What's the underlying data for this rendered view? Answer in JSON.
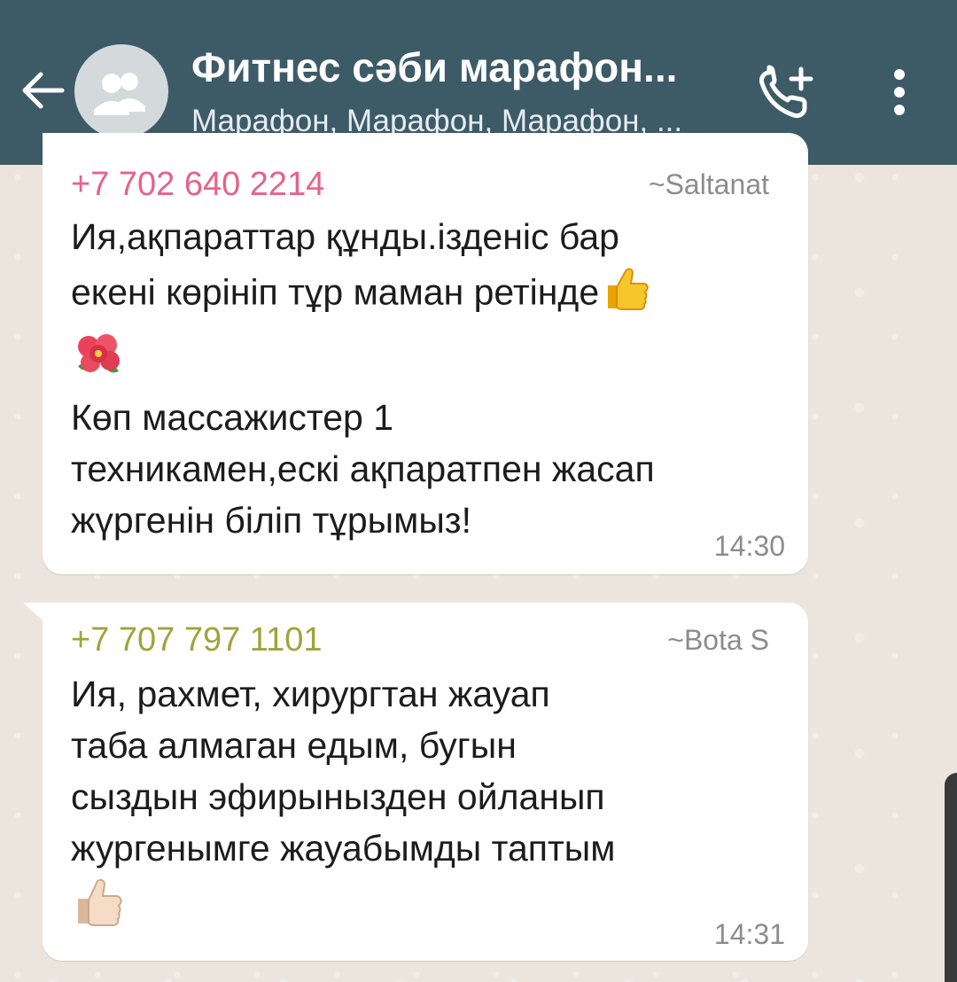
{
  "header": {
    "back_icon": "arrow-left-icon",
    "avatar_icon": "group-avatar-icon",
    "title": "Фитнес сәби марафон...",
    "subtitle": "Марафон, Марафон, Марафон, ...",
    "call_icon": "add-call-icon",
    "menu_icon": "more-vertical-icon",
    "bg_color": "#3d5a67"
  },
  "messages": [
    {
      "phone": "+7 702 640 2214",
      "phone_color": "#e8618c",
      "alias": "~Saltanat",
      "line1": "Ия,ақпараттар құнды.ізденіс бар",
      "line2": "екені көрініп тұр маман ретінде",
      "emoji_after_line2": "thumbs-up-icon",
      "emoji_line": "hibiscus-icon",
      "line3": "Көп массажистер 1",
      "line4": "техникамен,ескі ақпаратпен жасап",
      "line5": "жүргенін біліп тұрымыз!",
      "time": "14:30"
    },
    {
      "phone": "+7 707 797 1101",
      "phone_color": "#9aa63a",
      "alias": "~Bota S",
      "line1": "Ия, рахмет, хирургтан жауап",
      "line2": "таба алмаган едым, бугын",
      "line3": "сыздын эфирынызден ойланып",
      "line4": "жургенымге жауабымды таптым",
      "emoji_line": "thumbs-up-light-icon",
      "time": "14:31"
    }
  ]
}
